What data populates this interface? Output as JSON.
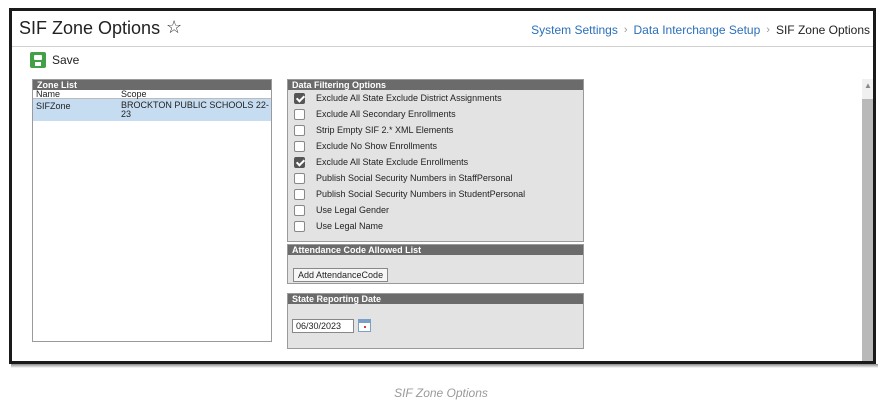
{
  "header": {
    "title": "SIF Zone Options",
    "breadcrumb": [
      "System Settings",
      "Data Interchange Setup",
      "SIF Zone Options"
    ]
  },
  "toolbar": {
    "save_label": "Save"
  },
  "zone_list": {
    "title": "Zone List",
    "columns": [
      "Name",
      "Scope"
    ],
    "rows": [
      {
        "name": "SIFZone",
        "scope": "BROCKTON PUBLIC SCHOOLS 22-23"
      }
    ]
  },
  "data_filtering": {
    "title": "Data Filtering Options",
    "options": [
      {
        "label": "Exclude All State Exclude District Assignments",
        "checked": true
      },
      {
        "label": "Exclude All Secondary Enrollments",
        "checked": false
      },
      {
        "label": "Strip Empty SIF 2.* XML Elements",
        "checked": false
      },
      {
        "label": "Exclude No Show Enrollments",
        "checked": false
      },
      {
        "label": "Exclude All State Exclude Enrollments",
        "checked": true
      },
      {
        "label": "Publish Social Security Numbers in StaffPersonal",
        "checked": false
      },
      {
        "label": "Publish Social Security Numbers in StudentPersonal",
        "checked": false
      },
      {
        "label": "Use Legal Gender",
        "checked": false
      },
      {
        "label": "Use Legal Name",
        "checked": false
      }
    ]
  },
  "attendance": {
    "title": "Attendance Code Allowed List",
    "add_label": "Add AttendanceCode"
  },
  "state_reporting": {
    "title": "State Reporting Date",
    "date_value": "06/30/2023"
  },
  "caption": "SIF Zone Options",
  "colors": {
    "link": "#2a6fba",
    "save_green": "#43a047",
    "panel_header": "#6b6b6b",
    "selected_row": "#c6dcf0"
  }
}
